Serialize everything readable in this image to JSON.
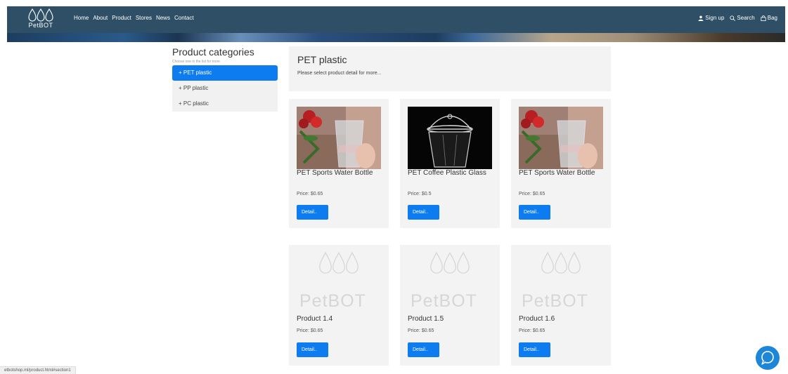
{
  "brand": {
    "name": "PetBOT"
  },
  "nav": {
    "links": [
      "Home",
      "About",
      "Product",
      "Stores",
      "News",
      "Contact"
    ],
    "signup": "Sign up",
    "search": "Search",
    "bag": "Bag"
  },
  "sidebar": {
    "title": "Product categories",
    "hint": "Choose one in the list for more",
    "items": [
      "+ PET plastic",
      "+ PP plastic",
      "+ PC plastic"
    ],
    "active_index": 0
  },
  "main": {
    "title": "PET plastic",
    "subtitle": "Please select product detail for more..."
  },
  "products": [
    {
      "name": "PET Sports Water Bottle",
      "price": "Price: $0.65",
      "button": "Detail..",
      "image": "cup-with-roses"
    },
    {
      "name": "PET Coffee Plastic Glass",
      "price": "Price: $0.5",
      "button": "Detail..",
      "image": "cup-with-dome-lid"
    },
    {
      "name": "PET Sports Water Bottle",
      "price": "Price: $0.65",
      "button": "Detail..",
      "image": "cup-with-roses"
    },
    {
      "name": "Product 1.4",
      "price": "Price: $0.65",
      "button": "Detail..",
      "image": "petbot-placeholder"
    },
    {
      "name": "Product 1.5",
      "price": "Price: $0.65",
      "button": "Detail..",
      "image": "petbot-placeholder"
    },
    {
      "name": "Product 1.6",
      "price": "Price: $0.65",
      "button": "Detail..",
      "image": "petbot-placeholder"
    }
  ],
  "status_bar": {
    "url": "etbotshop.ml/product.html#section1"
  },
  "colors": {
    "navbar": "#2e4f66",
    "accent": "#0d7cf0",
    "chat": "#1e86d8",
    "panel": "#f3f3f3"
  }
}
